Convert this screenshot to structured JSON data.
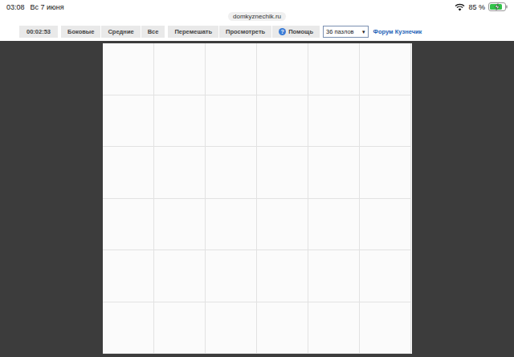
{
  "status_bar": {
    "time": "03:08",
    "date": "Вс 7 июня",
    "battery": "85 %",
    "battery_level": 0.85,
    "charging": true
  },
  "address_bar": {
    "url": "domkyznechik.ru"
  },
  "toolbar": {
    "timer": "00:02:53",
    "piece_filters": [
      {
        "label": "Боковые",
        "selected": false
      },
      {
        "label": "Средние",
        "selected": false
      },
      {
        "label": "Все",
        "selected": false
      }
    ],
    "actions": [
      {
        "label": "Перемешать",
        "icon": ""
      },
      {
        "label": "Просмотреть",
        "icon": ""
      },
      {
        "label": "Помощь",
        "icon": "?"
      }
    ],
    "pieces_select": {
      "value": "36 пазлов",
      "arrow": "▾"
    },
    "forum_link": "Форум Кузнечик"
  },
  "puzzle": {
    "rows": 6,
    "columns": 6
  }
}
